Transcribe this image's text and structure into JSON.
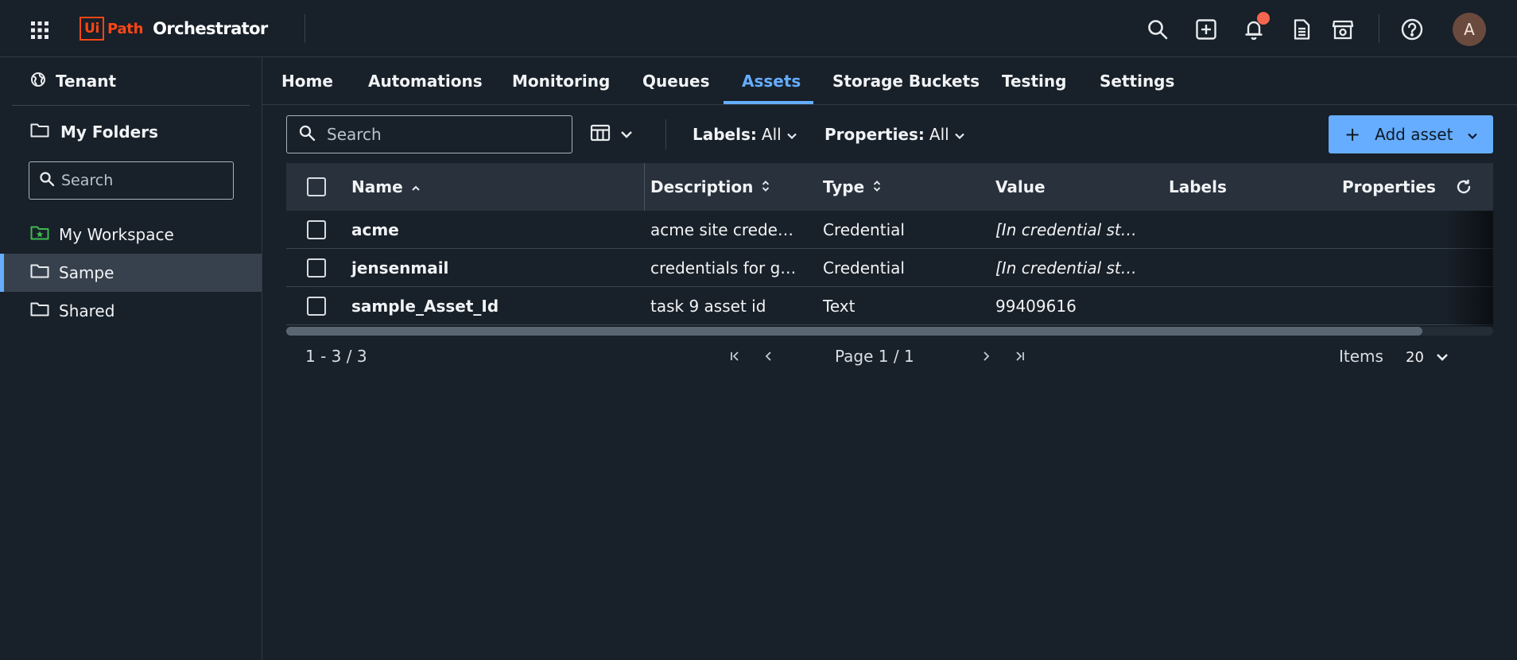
{
  "header": {
    "logo_box": "Ui",
    "logo_path": "Path",
    "product": "Orchestrator",
    "avatar_initial": "A",
    "icons": [
      "apps-grid-icon",
      "search-icon",
      "add-square-icon",
      "bell-icon",
      "document-icon",
      "store-icon",
      "help-icon"
    ]
  },
  "sidebar": {
    "tenant_label": "Tenant",
    "my_folders_label": "My Folders",
    "search_placeholder": "Search",
    "items": [
      {
        "label": "My Workspace",
        "icon": "workspace-folder-icon"
      },
      {
        "label": "Sampe",
        "icon": "folder-icon",
        "active": true
      },
      {
        "label": "Shared",
        "icon": "folder-icon"
      }
    ]
  },
  "tabs": [
    {
      "label": "Home"
    },
    {
      "label": "Automations"
    },
    {
      "label": "Monitoring"
    },
    {
      "label": "Queues"
    },
    {
      "label": "Assets",
      "active": true
    },
    {
      "label": "Storage Buckets"
    },
    {
      "label": "Testing"
    },
    {
      "label": "Settings"
    }
  ],
  "toolbar": {
    "search_placeholder": "Search",
    "labels_filter": {
      "label": "Labels:",
      "value": "All"
    },
    "properties_filter": {
      "label": "Properties:",
      "value": "All"
    },
    "add_button": "Add asset"
  },
  "table": {
    "columns": [
      "Name",
      "Description",
      "Type",
      "Value",
      "Labels",
      "Properties"
    ],
    "rows": [
      {
        "name": "acme",
        "description": "acme site crede…",
        "type": "Credential",
        "value": "[In credential st…",
        "value_italic": true
      },
      {
        "name": "jensenmail",
        "description": "credentials for g…",
        "type": "Credential",
        "value": "[In credential st…",
        "value_italic": true
      },
      {
        "name": "sample_Asset_Id",
        "description": "task 9 asset id",
        "type": "Text",
        "value": "99409616",
        "value_italic": false
      }
    ]
  },
  "pagination": {
    "range": "1 - 3 / 3",
    "page_text": "Page 1 / 1",
    "items_label": "Items",
    "items_value": "20"
  },
  "colors": {
    "background": "#182029",
    "accent": "#66adff",
    "brand": "#fa4616",
    "notification": "#f4664f"
  }
}
